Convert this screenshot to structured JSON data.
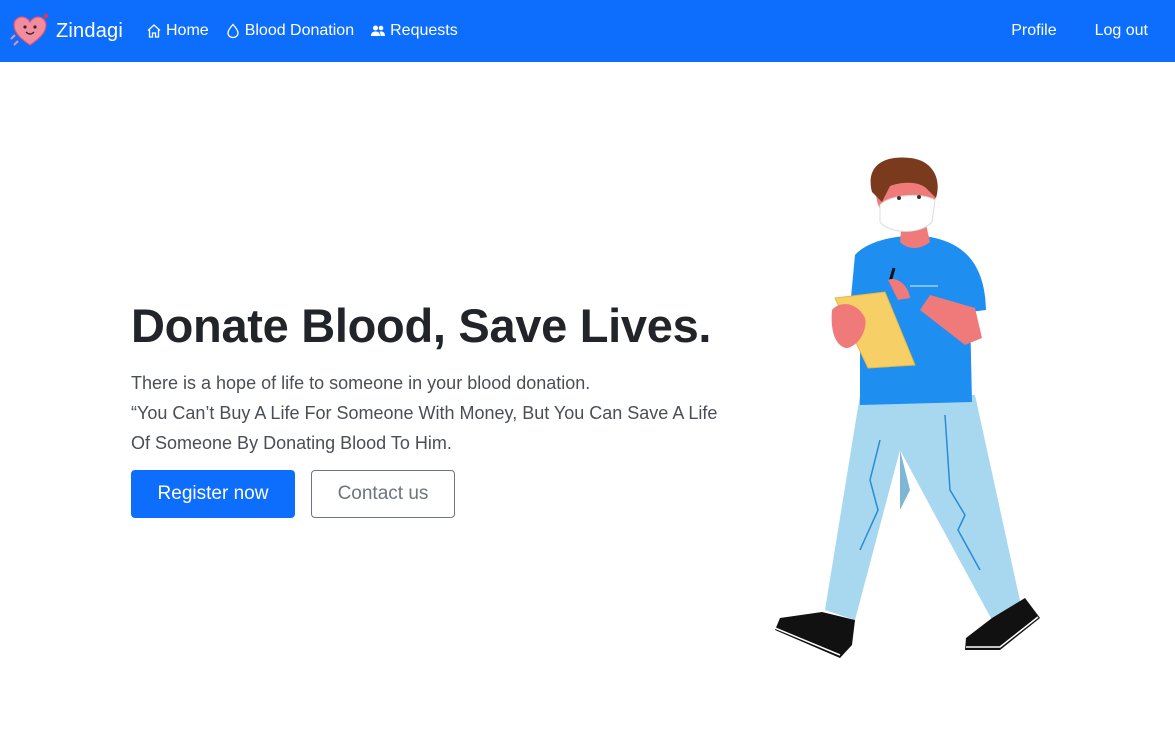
{
  "navbar": {
    "brand": {
      "name": "Zindagi",
      "logo_icon": "heart-mascot-icon"
    },
    "links": [
      {
        "label": "Home",
        "icon": "house-icon"
      },
      {
        "label": "Blood Donation",
        "icon": "droplet-icon"
      },
      {
        "label": "Requests",
        "icon": "people-icon"
      }
    ],
    "right_links": [
      {
        "label": "Profile"
      },
      {
        "label": "Log out"
      }
    ],
    "background_color": "#0d6efd"
  },
  "hero": {
    "title": "Donate Blood, Save Lives.",
    "line1": "There is a hope of life to someone in your blood donation.",
    "line2": "“You Can’t Buy A Life For Someone With Money, But You Can Save A Life Of Someone By Donating Blood To Him.",
    "primary_button": "Register now",
    "secondary_button": "Contact us",
    "illustration": "doctor-walking-with-clipboard-illustration"
  },
  "colors": {
    "primary": "#0d6efd",
    "secondary": "#6c757d"
  }
}
